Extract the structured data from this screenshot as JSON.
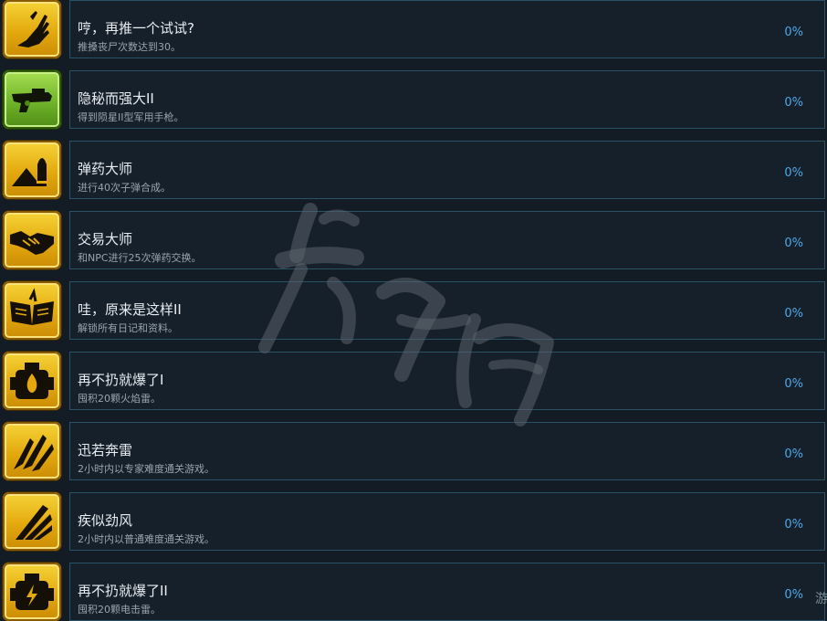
{
  "achievements": [
    {
      "title": "哼，再推一个试试?",
      "description": "推搡丧尸次数达到30。",
      "progress": "0%",
      "icon": "hand-push-icon",
      "color": "#e3a90e"
    },
    {
      "title": "隐秘而强大II",
      "description": "得到陨星II型军用手枪。",
      "progress": "0%",
      "icon": "pistol-icon",
      "color": "#6fb42a"
    },
    {
      "title": "弹药大师",
      "description": "进行40次子弹合成。",
      "progress": "0%",
      "icon": "bullet-icon",
      "color": "#e3a90e"
    },
    {
      "title": "交易大师",
      "description": "和NPC进行25次弹药交换。",
      "progress": "0%",
      "icon": "handshake-icon",
      "color": "#e3a90e"
    },
    {
      "title": "哇，原来是这样II",
      "description": "解锁所有日记和资料。",
      "progress": "0%",
      "icon": "open-book-icon",
      "color": "#e3a90e"
    },
    {
      "title": "再不扔就爆了I",
      "description": "囤积20颗火焰雷。",
      "progress": "0%",
      "icon": "fire-grenade-icon",
      "color": "#e3a90e"
    },
    {
      "title": "迅若奔雷",
      "description": "2小时内以专家难度通关游戏。",
      "progress": "0%",
      "icon": "double-wing-icon",
      "color": "#e3a90e"
    },
    {
      "title": "疾似劲风",
      "description": "2小时内以普通难度通关游戏。",
      "progress": "0%",
      "icon": "wing-icon",
      "color": "#e3a90e"
    },
    {
      "title": "再不扔就爆了II",
      "description": "囤积20颗电击雷。",
      "progress": "0%",
      "icon": "electric-grenade-icon",
      "color": "#e3a90e"
    }
  ],
  "edge_text": "游"
}
